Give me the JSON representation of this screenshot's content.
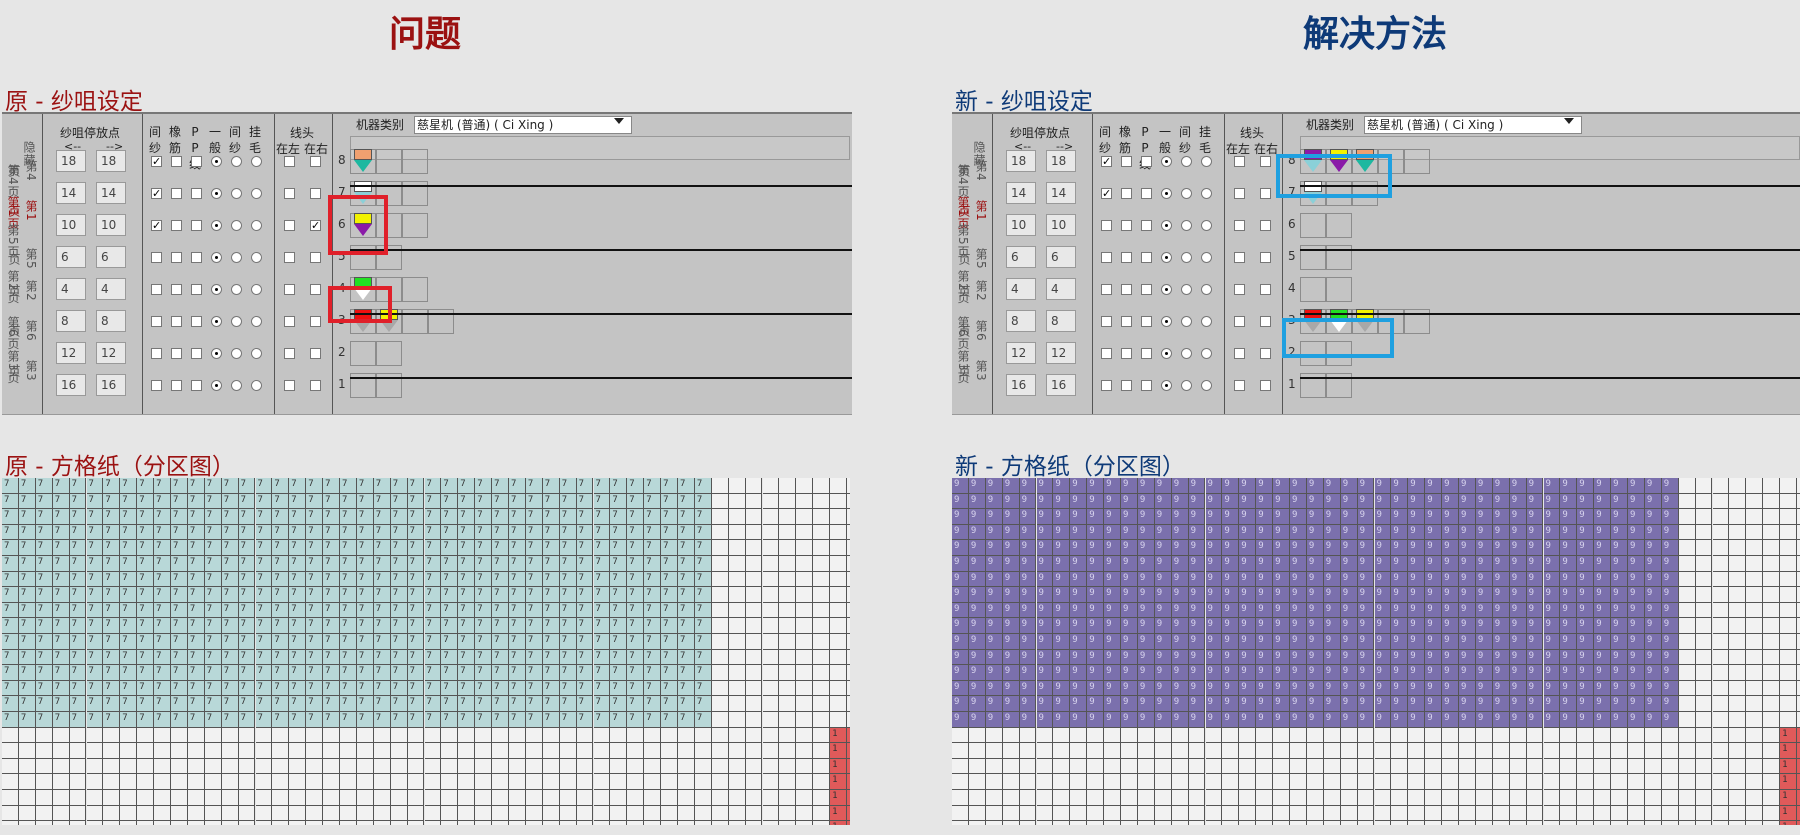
{
  "headings": {
    "problem": "问题",
    "solution": "解决方法"
  },
  "sections": {
    "orig_settings": "原 - 纱咀设定",
    "new_settings": "新 - 纱咀设定",
    "orig_grid": "原 - 方格纸（分区图）",
    "new_grid": "新 - 方格纸（分区图）"
  },
  "header": {
    "hide": "隐藏",
    "stop_point": "纱咀停放点",
    "arrows_left": "<--",
    "arrows_right": "-->",
    "cols": [
      "间纱",
      "橡筋",
      "PP线",
      "一般",
      "间纱",
      "挂毛"
    ],
    "thread_end": "线头",
    "left": "在左",
    "right": "在右",
    "machine_label": "机器类别",
    "machine_value": "慈星机 (普通) ( Ci Xing )"
  },
  "page_tabs": {
    "p4": "第4页",
    "p1": "第1页",
    "p5": "第5页",
    "p2": "第2页",
    "p6": "第6页",
    "p3": "第3页"
  },
  "orig_panel": {
    "rows": [
      {
        "num": "8",
        "v1": "18",
        "v2": "18"
      },
      {
        "num": "7",
        "v1": "14",
        "v2": "14"
      },
      {
        "num": "6",
        "v1": "10",
        "v2": "10"
      },
      {
        "num": "5",
        "v1": "6",
        "v2": "6"
      },
      {
        "num": "4",
        "v1": "4",
        "v2": "4"
      },
      {
        "num": "3",
        "v1": "8",
        "v2": "8"
      },
      {
        "num": "2",
        "v1": "12",
        "v2": "12"
      },
      {
        "num": "1",
        "v1": "16",
        "v2": "16"
      }
    ]
  },
  "new_panel": {
    "rows": [
      {
        "num": "8",
        "v1": "18",
        "v2": "18"
      },
      {
        "num": "7",
        "v1": "14",
        "v2": "14"
      },
      {
        "num": "6",
        "v1": "10",
        "v2": "10"
      },
      {
        "num": "5",
        "v1": "6",
        "v2": "6"
      },
      {
        "num": "4",
        "v1": "4",
        "v2": "4"
      },
      {
        "num": "3",
        "v1": "8",
        "v2": "8"
      },
      {
        "num": "2",
        "v1": "12",
        "v2": "12"
      },
      {
        "num": "1",
        "v1": "16",
        "v2": "16"
      }
    ]
  },
  "grid_labels": {
    "orig_fill": "7",
    "orig_corner": "1",
    "new_fill": "9",
    "new_corner": "1"
  },
  "colors": {
    "orig_fill": "#b8d8d8",
    "new_fill": "#7b70ad",
    "corner": "#e05a5a",
    "highlight_red": "#e0202a",
    "highlight_blue": "#1fa0e0",
    "feeder_orange": "#f0a070",
    "feeder_teal": "#1eb8a0",
    "feeder_white": "#ffffff",
    "feeder_lightblue": "#8ad0d8",
    "feeder_yellow": "#f2f200",
    "feeder_purple": "#8a1aa8",
    "feeder_green": "#22e022",
    "feeder_red": "#ee1010",
    "feeder_grey": "#a8a8a8"
  }
}
